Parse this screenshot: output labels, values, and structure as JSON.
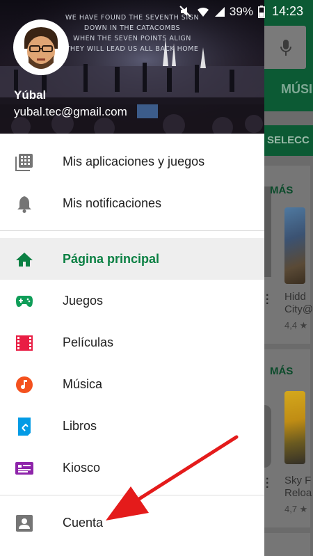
{
  "status_bar": {
    "battery_percent": "39%",
    "time": "14:23"
  },
  "header": {
    "banner_lines": [
      "WE HAVE FOUND THE SEVENTH SIGN",
      "DOWN IN THE CATACOMBS",
      "WHEN THE SEVEN POINTS ALIGN",
      "THEY WILL LEAD US ALL BACK HOME"
    ],
    "user_name": "Yúbal",
    "user_email": "yubal.tec@gmail.com"
  },
  "menu": {
    "top": [
      {
        "label": "Mis aplicaciones y juegos",
        "icon": "apps-grid-icon"
      },
      {
        "label": "Mis notificaciones",
        "icon": "bell-icon"
      }
    ],
    "sections": [
      {
        "label": "Página principal",
        "icon": "home-icon",
        "active": true,
        "color": "#0b8043"
      },
      {
        "label": "Juegos",
        "icon": "gamepad-icon",
        "color": "#0f9d58"
      },
      {
        "label": "Películas",
        "icon": "film-icon",
        "color": "#e91e44"
      },
      {
        "label": "Música",
        "icon": "music-note-icon",
        "color": "#f4511e"
      },
      {
        "label": "Libros",
        "icon": "book-icon",
        "color": "#039be5"
      },
      {
        "label": "Kiosco",
        "icon": "newsstand-icon",
        "color": "#8e24aa"
      }
    ],
    "bottom": [
      {
        "label": "Cuenta",
        "icon": "account-icon"
      }
    ]
  },
  "background_app": {
    "tab_label": "MÚSI",
    "strip_label": "SELECC",
    "cards": [
      {
        "more_label": "MÁS",
        "title_line1": "Hidd",
        "title_line2": "City@",
        "rating": "4,4 ★"
      },
      {
        "more_label": "MÁS",
        "title_line1": "Sky F",
        "title_line2": "Reloa",
        "rating": "4,7 ★"
      }
    ]
  }
}
